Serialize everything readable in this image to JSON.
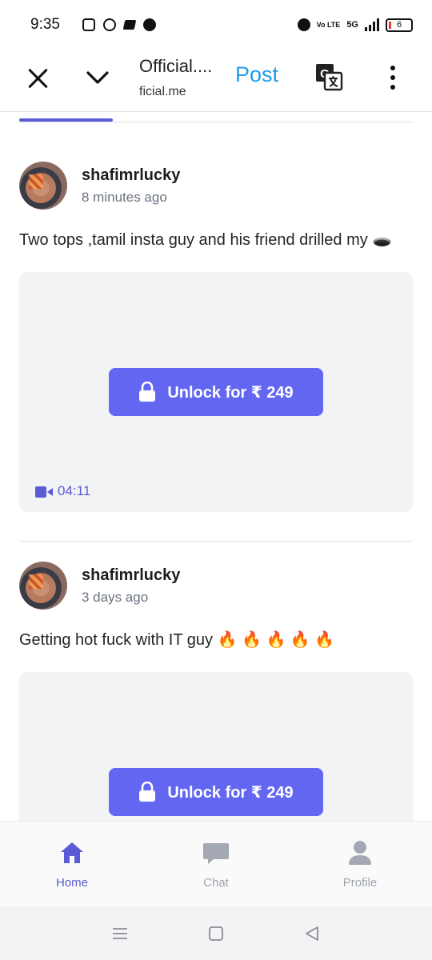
{
  "status_bar": {
    "time": "9:35",
    "network": "5G",
    "volte": "Vo LTE",
    "battery": "6"
  },
  "header": {
    "title": "Official....",
    "url": "ficial.me",
    "post_label": "Post",
    "close_icon": "close-icon",
    "chevron_icon": "chevron-down-icon",
    "translate_icon": "translate-icon",
    "more_icon": "more-vert-icon"
  },
  "posts": [
    {
      "author": "shafimrlucky",
      "time": "8 minutes ago",
      "text": "Two tops ,tamil insta guy and his friend drilled my 🕳️",
      "unlock_label": "Unlock for ₹ 249",
      "duration": "04:11"
    },
    {
      "author": "shafimrlucky",
      "time": "3 days ago",
      "text": "Getting hot fuck with IT guy 🔥 🔥 🔥 🔥 🔥",
      "unlock_label": "Unlock for ₹ 249"
    }
  ],
  "bottom_nav": {
    "items": [
      {
        "label": "Home",
        "icon": "home-icon",
        "active": true
      },
      {
        "label": "Chat",
        "icon": "chat-icon",
        "active": false
      },
      {
        "label": "Profile",
        "icon": "profile-icon",
        "active": false
      }
    ]
  },
  "colors": {
    "accent": "#6366f1",
    "post_link": "#1e9be8",
    "media_bg": "#f2f3f5"
  }
}
